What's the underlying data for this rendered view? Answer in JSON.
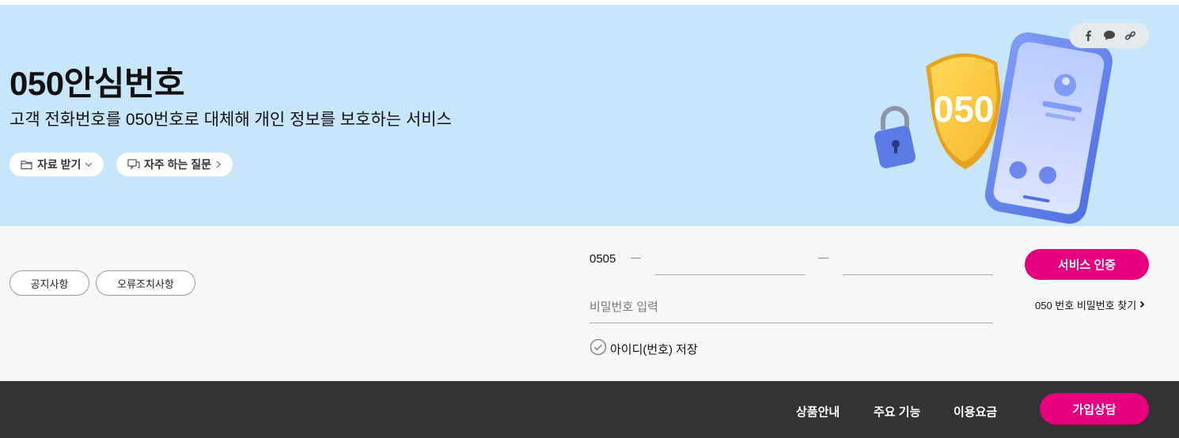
{
  "hero": {
    "title": "050안심번호",
    "subtitle": "고객 전화번호를 050번호로 대체해 개인 정보를 보호하는 서비스",
    "download_label": "자료 받기",
    "faq_label": "자주 하는 질문",
    "badge_text": "050",
    "share_icons": [
      "facebook-icon",
      "chat-bubble-icon",
      "link-icon"
    ]
  },
  "login": {
    "notice_label": "공지사항",
    "error_label": "오류조치사항",
    "prefix": "0505",
    "middle_value": "",
    "last_value": "",
    "password_placeholder": "비밀번호 입력",
    "save_id_label": "아이디(번호) 저장",
    "auth_button": "서비스 인증",
    "find_password": "050 번호 비밀번호 찾기"
  },
  "footer": {
    "nav": [
      "상품안내",
      "주요 기능",
      "이용요금"
    ],
    "join_button": "가입상담"
  },
  "colors": {
    "hero_bg": "#c8e6f9",
    "accent": "#e6007e",
    "footer_bg": "#333333",
    "login_bg": "#f7f7f7"
  }
}
